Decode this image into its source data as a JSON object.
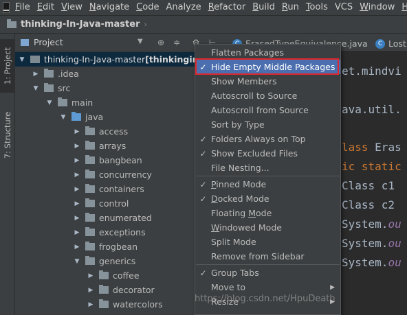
{
  "menubar": {
    "items": [
      {
        "label": "File",
        "mnemonic": "F",
        "rest": "ile"
      },
      {
        "label": "Edit",
        "mnemonic": "E",
        "rest": "dit"
      },
      {
        "label": "View",
        "mnemonic": "V",
        "rest": "iew"
      },
      {
        "label": "Navigate",
        "mnemonic": "N",
        "rest": "avigate"
      },
      {
        "label": "Code",
        "mnemonic": "C",
        "rest": "ode"
      },
      {
        "label": "Analyze",
        "mnemonic": "",
        "rest": "Analyze"
      },
      {
        "label": "Refactor",
        "mnemonic": "R",
        "rest": "efactor"
      },
      {
        "label": "Build",
        "mnemonic": "B",
        "rest": "uild"
      },
      {
        "label": "Run",
        "mnemonic": "R",
        "rest": "un"
      },
      {
        "label": "Tools",
        "mnemonic": "T",
        "rest": "ools"
      },
      {
        "label": "VCS",
        "mnemonic": "",
        "rest": "VCS"
      },
      {
        "label": "Window",
        "mnemonic": "W",
        "rest": "indow"
      },
      {
        "label": "Help",
        "mnemonic": "H",
        "rest": "elp"
      }
    ]
  },
  "navbar": {
    "crumb": "thinking-In-Java-master"
  },
  "left_stripe": {
    "project_label": "1: Project",
    "structure_label": "7: Structure"
  },
  "project_panel": {
    "title": "Project",
    "tree": [
      {
        "label": "thinking-In-Java-master",
        "suffix": " [thinkinginja",
        "depth": 0,
        "arrow": "▼",
        "kind": "root",
        "selected": true
      },
      {
        "label": ".idea",
        "depth": 1,
        "arrow": "▶",
        "kind": "folder"
      },
      {
        "label": "src",
        "depth": 1,
        "arrow": "▼",
        "kind": "folder"
      },
      {
        "label": "main",
        "depth": 2,
        "arrow": "▼",
        "kind": "folder"
      },
      {
        "label": "java",
        "depth": 3,
        "arrow": "▼",
        "kind": "source"
      },
      {
        "label": "access",
        "depth": 4,
        "arrow": "▶",
        "kind": "package"
      },
      {
        "label": "arrays",
        "depth": 4,
        "arrow": "▶",
        "kind": "package"
      },
      {
        "label": "bangbean",
        "depth": 4,
        "arrow": "▶",
        "kind": "package"
      },
      {
        "label": "concurrency",
        "depth": 4,
        "arrow": "▶",
        "kind": "package"
      },
      {
        "label": "containers",
        "depth": 4,
        "arrow": "▶",
        "kind": "package"
      },
      {
        "label": "control",
        "depth": 4,
        "arrow": "▶",
        "kind": "package"
      },
      {
        "label": "enumerated",
        "depth": 4,
        "arrow": "▶",
        "kind": "package"
      },
      {
        "label": "exceptions",
        "depth": 4,
        "arrow": "▶",
        "kind": "package"
      },
      {
        "label": "frogbean",
        "depth": 4,
        "arrow": "▶",
        "kind": "package"
      },
      {
        "label": "generics",
        "depth": 4,
        "arrow": "▼",
        "kind": "package"
      },
      {
        "label": "coffee",
        "depth": 5,
        "arrow": "▶",
        "kind": "package"
      },
      {
        "label": "decorator",
        "depth": 5,
        "arrow": "▶",
        "kind": "package"
      },
      {
        "label": "watercolors",
        "depth": 5,
        "arrow": "▶",
        "kind": "package"
      }
    ]
  },
  "editor": {
    "tab1": "ErasedTypeEquivalence.java",
    "tab1_visible": "ErasedTypeEquivalence.java",
    "tab2": "Lost",
    "tab2_icon": "C",
    "code_lines": [
      {
        "parts": [
          {
            "t": "et.mindvi",
            "c": ""
          }
        ]
      },
      {
        "parts": [
          {
            "t": "ava.util.",
            "c": ""
          }
        ]
      },
      {
        "parts": [
          {
            "t": "lass ",
            "c": "kw"
          },
          {
            "t": "Eras",
            "c": ""
          }
        ]
      },
      {
        "parts": [
          {
            "t": "ic static",
            "c": "kw"
          }
        ]
      },
      {
        "parts": [
          {
            "t": "Class c1",
            "c": ""
          }
        ]
      },
      {
        "parts": [
          {
            "t": "Class c2",
            "c": ""
          }
        ]
      },
      {
        "parts": [
          {
            "t": "System.",
            "c": ""
          },
          {
            "t": "ou",
            "c": "it"
          }
        ]
      },
      {
        "parts": [
          {
            "t": "System.",
            "c": ""
          },
          {
            "t": "ou",
            "c": "it"
          }
        ]
      },
      {
        "parts": [
          {
            "t": "System.",
            "c": ""
          },
          {
            "t": "ou",
            "c": "it"
          }
        ]
      }
    ]
  },
  "context_menu": {
    "items": [
      {
        "label": "Flatten Packages",
        "checked": false,
        "submenu": false,
        "mnemonic_index": -1
      },
      {
        "label": "Hide Empty Middle Packages",
        "checked": true,
        "submenu": false,
        "highlighted": true,
        "mnemonic_index": -1
      },
      {
        "label": "Show Members",
        "checked": false,
        "submenu": false,
        "mnemonic_index": -1
      },
      {
        "label": "Autoscroll to Source",
        "checked": false,
        "submenu": false,
        "mnemonic_index": -1
      },
      {
        "label": "Autoscroll from Source",
        "checked": false,
        "submenu": false,
        "mnemonic_index": -1
      },
      {
        "label": "Sort by Type",
        "checked": false,
        "submenu": false,
        "mnemonic_index": -1
      },
      {
        "label": "Folders Always on Top",
        "checked": true,
        "submenu": false,
        "mnemonic_index": -1
      },
      {
        "label": "Show Excluded Files",
        "checked": true,
        "submenu": false,
        "mnemonic_index": -1
      },
      {
        "label": "File Nesting...",
        "checked": false,
        "submenu": false,
        "mnemonic_index": -1,
        "separator_after": true
      },
      {
        "label": "Pinned Mode",
        "checked": true,
        "submenu": false,
        "mnemonic_index": 0
      },
      {
        "label": "Docked Mode",
        "checked": true,
        "submenu": false,
        "mnemonic_index": 0
      },
      {
        "label": "Floating Mode",
        "checked": false,
        "submenu": false,
        "mnemonic_index": 9
      },
      {
        "label": "Windowed Mode",
        "checked": false,
        "submenu": false,
        "mnemonic_index": 0
      },
      {
        "label": "Split Mode",
        "checked": false,
        "submenu": false,
        "mnemonic_index": -1
      },
      {
        "label": "Remove from Sidebar",
        "checked": false,
        "submenu": false,
        "mnemonic_index": -1,
        "separator_after": true
      },
      {
        "label": "Group Tabs",
        "checked": true,
        "submenu": false,
        "mnemonic_index": -1
      },
      {
        "label": "Move to",
        "checked": false,
        "submenu": true,
        "mnemonic_index": -1
      },
      {
        "label": "Resize",
        "checked": false,
        "submenu": true,
        "mnemonic_index": -1
      }
    ]
  },
  "watermark": "https://blog.csdn.net/HpuDeath",
  "colors": {
    "accent_highlight": "#4b6eaf",
    "callout_border": "#e0262a",
    "selection": "#0d293e",
    "editor_bg": "#2b2b2b",
    "panel_bg": "#3c3f41"
  }
}
